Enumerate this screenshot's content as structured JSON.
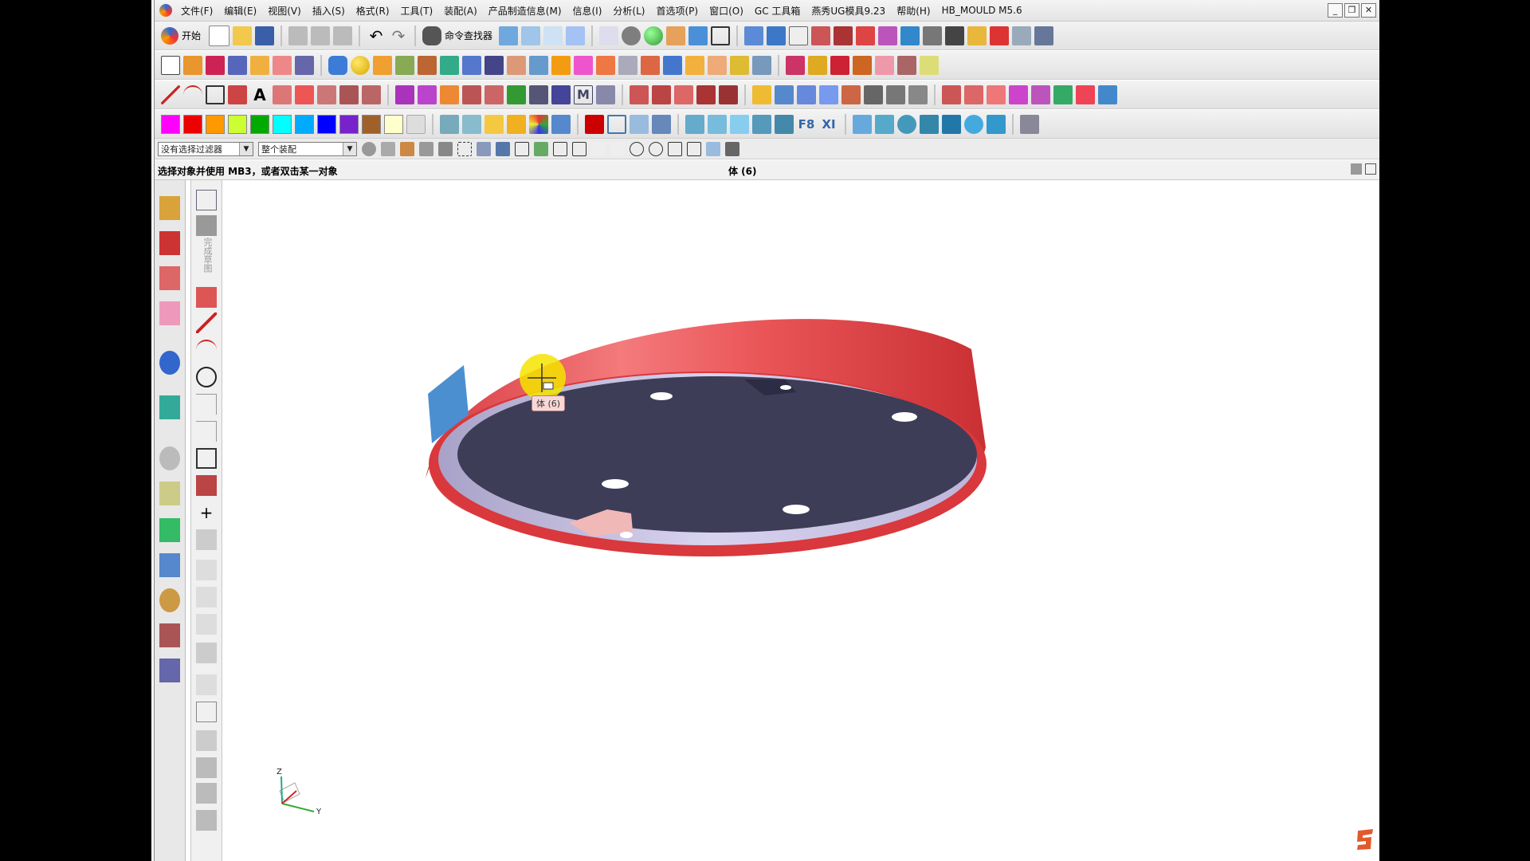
{
  "menubar": {
    "items": [
      "文件(F)",
      "编辑(E)",
      "视图(V)",
      "插入(S)",
      "格式(R)",
      "工具(T)",
      "装配(A)",
      "产品制造信息(M)",
      "信息(I)",
      "分析(L)",
      "首选项(P)",
      "窗口(O)",
      "GC 工具箱",
      "燕秀UG模具9.23",
      "帮助(H)",
      "HB_MOULD M5.6"
    ],
    "window_buttons": [
      "_",
      "❐",
      "✕"
    ]
  },
  "toolbar": {
    "start_label": "开始",
    "command_finder_label": "命令查找器"
  },
  "colors": {
    "swatches": [
      "#ff00ff",
      "#ee0000",
      "#ff9900",
      "#ccff33",
      "#00aa00",
      "#00ffff",
      "#00aaff",
      "#0000ff",
      "#7722cc",
      "#a0602a",
      "#ffffcc"
    ],
    "part_red": "#e5484b",
    "part_dark": "#3e3d57",
    "accent_blue": "#4b8fd0"
  },
  "selection": {
    "filter_value": "没有选择过滤器",
    "scope_value": "整个装配"
  },
  "status": {
    "prompt": "选择对象并使用 MB3，或者双击某一对象",
    "selection_info": "体 (6)"
  },
  "viewport": {
    "tooltip": "体 (6)",
    "axis_z": "Z",
    "axis_y": "Y"
  },
  "sketch_bar": {
    "vertical_label": "完成草图"
  }
}
